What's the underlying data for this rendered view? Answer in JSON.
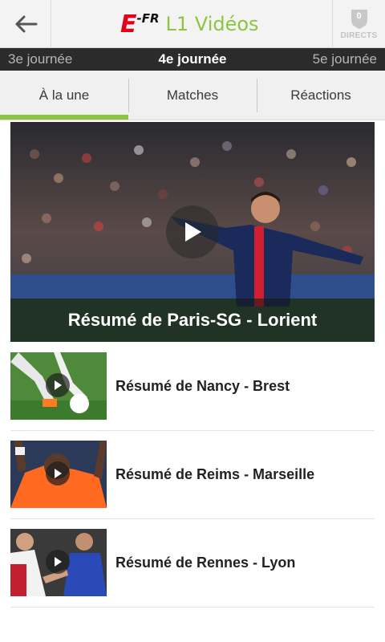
{
  "header": {
    "back_icon": "arrow-left-icon",
    "brand_logo": "E",
    "brand_suffix": "-FR",
    "title": "L1 Vidéos",
    "directs_count": "0",
    "directs_label": "DIRECTS",
    "accent_color": "#8cc63f",
    "brand_color": "#e2001a"
  },
  "journees": {
    "previous": "3e journée",
    "current": "4e journée",
    "next": "5e journée"
  },
  "tabs": [
    {
      "label": "À la une",
      "active": true
    },
    {
      "label": "Matches",
      "active": false
    },
    {
      "label": "Réactions",
      "active": false
    }
  ],
  "featured": {
    "title": "Résumé de Paris-SG - Lorient",
    "icon": "play-icon"
  },
  "videos": [
    {
      "title": "Résumé de Nancy - Brest",
      "icon": "play-icon"
    },
    {
      "title": "Résumé de Reims - Marseille",
      "icon": "play-icon"
    },
    {
      "title": "Résumé de Rennes - Lyon",
      "icon": "play-icon"
    }
  ]
}
